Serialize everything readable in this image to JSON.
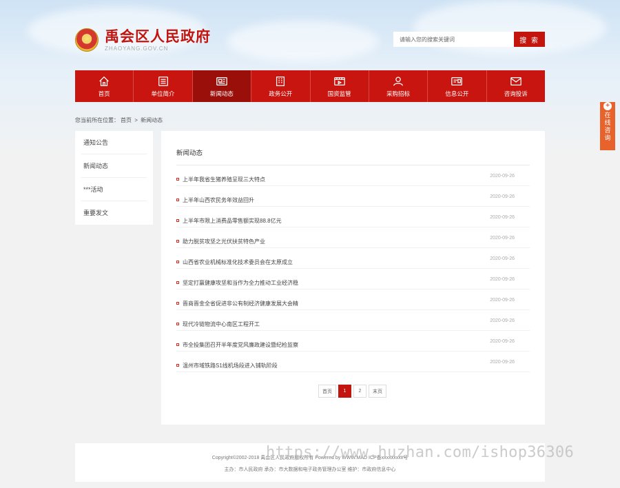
{
  "header": {
    "site_title": "禹会区人民政府",
    "site_subtitle": "ZHAOYANG.GOV.CN",
    "search_placeholder": "请输入您的搜索关键词",
    "search_button": "搜 索"
  },
  "nav": [
    {
      "label": "首页",
      "icon": "home-icon"
    },
    {
      "label": "单位简介",
      "icon": "list-icon"
    },
    {
      "label": "新闻动态",
      "icon": "news-icon",
      "active": true
    },
    {
      "label": "政务公开",
      "icon": "building-icon"
    },
    {
      "label": "国资监管",
      "icon": "video-icon"
    },
    {
      "label": "采购招标",
      "icon": "users-icon"
    },
    {
      "label": "信息公开",
      "icon": "id-card-icon"
    },
    {
      "label": "咨询投诉",
      "icon": "mail-icon"
    }
  ],
  "breadcrumb": {
    "prefix": "您当前所在位置：",
    "home": "首页",
    "sep": ">",
    "current": "新闻动态"
  },
  "sidebar": {
    "items": [
      {
        "label": "通知公告"
      },
      {
        "label": "新闻动态"
      },
      {
        "label": "***活动"
      },
      {
        "label": "重要发文"
      }
    ]
  },
  "main": {
    "title": "新闻动态",
    "news": [
      {
        "title": "上半年我省生猪养殖呈现三大特点",
        "date": "2020-09-26"
      },
      {
        "title": "上半年山西农民务年效益回升",
        "date": "2020-09-26"
      },
      {
        "title": "上半年市限上消费品零售额实现88.8亿元",
        "date": "2020-09-26"
      },
      {
        "title": "助力脱贫攻坚之光伏扶贫特色产业",
        "date": "2020-09-26"
      },
      {
        "title": "山西省农业机械标准化技术委员会在太原成立",
        "date": "2020-09-26"
      },
      {
        "title": "坚定打赢健康攻坚和当作为全力推动工业经济稳",
        "date": "2020-09-26"
      },
      {
        "title": "晋商晋金全省促进非公有制经济健康发展大会精",
        "date": "2020-09-26"
      },
      {
        "title": "现代冷链物流中心南区工程开工",
        "date": "2020-09-26"
      },
      {
        "title": "市全投集团召开半年度党风廉政建设暨纪检监察",
        "date": "2020-09-26"
      },
      {
        "title": "温州市域铁路S1线机场段进入铺轨阶段",
        "date": "2020-09-26"
      }
    ]
  },
  "pager": {
    "first": "首页",
    "pages": [
      "1",
      "2"
    ],
    "active": "1",
    "last": "末页"
  },
  "footer": {
    "copyright": "Copyright©2002-2018 禹会区人民政府版权所有 Powered by WWW.MAD ICP备xxxxxxxxx号",
    "host": "主办：市人民政府 承办：市大数据和电子政务管理办公室 维护：市政府信息中心"
  },
  "watermark": "https://www.huzhan.com/ishop36306",
  "float_consult": {
    "plus": "+",
    "chars": [
      "在",
      "线",
      "咨",
      "询"
    ]
  },
  "colors": {
    "brand_red": "#c8150f",
    "nav_active": "#9b0f0a",
    "consult_orange": "#e8622c"
  }
}
